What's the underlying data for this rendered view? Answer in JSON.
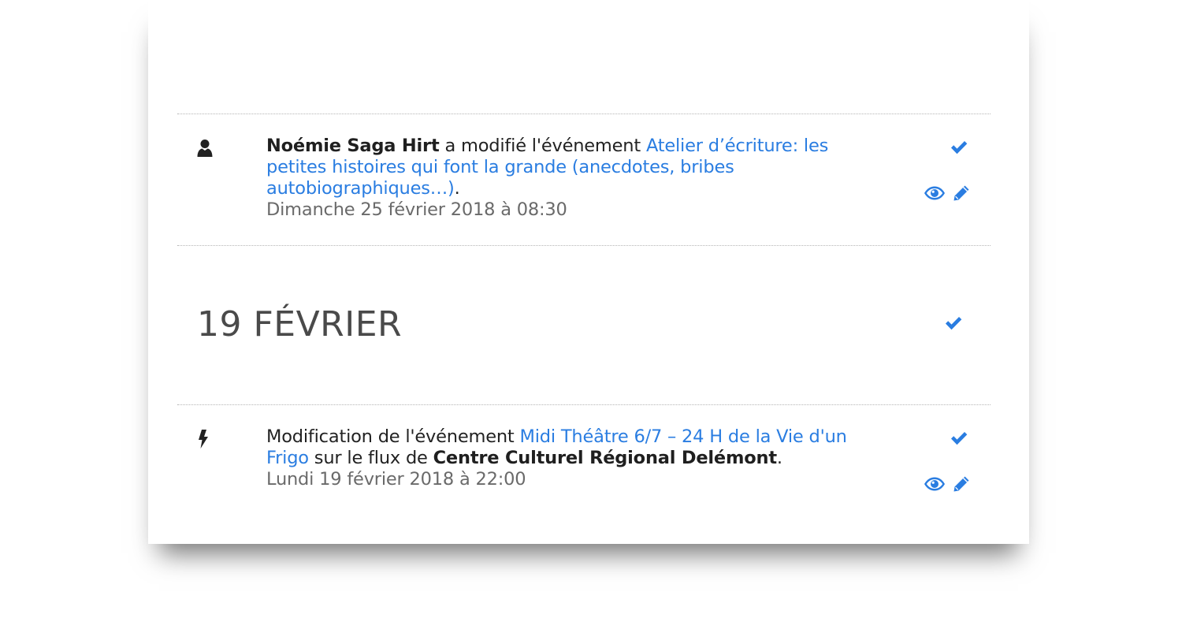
{
  "colors": {
    "accent": "#2a7de1",
    "text": "#222222",
    "muted": "#6a6a6a"
  },
  "entries": [
    {
      "icon": "user-icon",
      "actor": "Noémie Saga Hirt",
      "action": " a modifié l'événement ",
      "event_link": "Atelier d’écriture: les petites histoires qui font la grande (anecdotes, bribes autobiographiques…)",
      "suffix": ".",
      "date": "Dimanche 25 février 2018 à 08:30"
    },
    {
      "icon": "bolt-icon",
      "action": "Modification de l'événement ",
      "event_link": "Midi Théâtre 6/7 – 24 H de la Vie d'un Frigo",
      "middle": " sur le flux de ",
      "source": "Centre Culturel Régional Delémont",
      "suffix": ".",
      "date": "Lundi 19 février 2018 à 22:00"
    }
  ],
  "day_heading": "19 FÉVRIER"
}
